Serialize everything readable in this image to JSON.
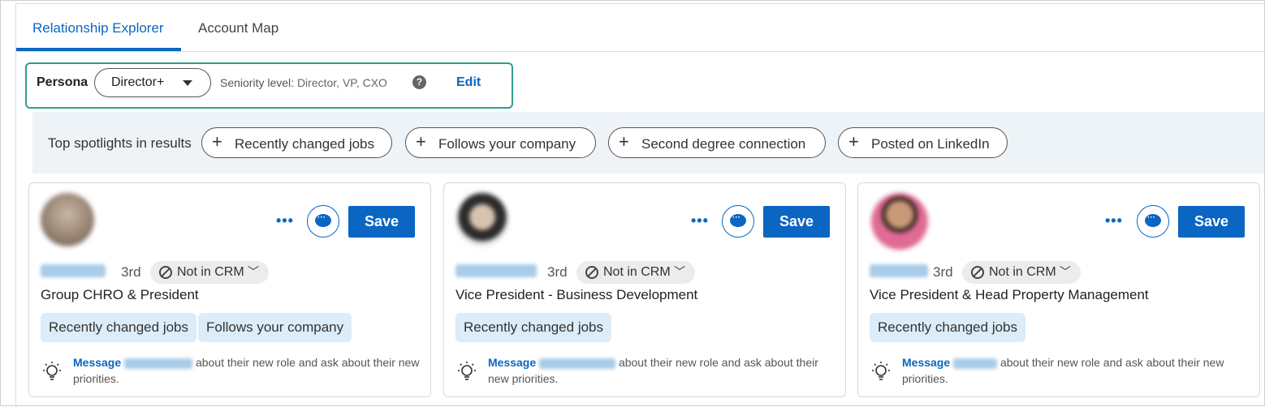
{
  "tabs": [
    {
      "label": "Relationship Explorer",
      "active": true
    },
    {
      "label": "Account Map",
      "active": false
    }
  ],
  "persona": {
    "label": "Persona",
    "selected": "Director+",
    "seniority_label": "Seniority level:",
    "seniority_value": "Director, VP, CXO",
    "edit_label": "Edit"
  },
  "spotlights": {
    "label": "Top spotlights in results",
    "items": [
      "Recently changed jobs",
      "Follows your company",
      "Second degree connection",
      "Posted on LinkedIn"
    ]
  },
  "colors": {
    "accent": "#0a66c2",
    "persona_border": "#2e9e8e",
    "tag_bg": "#dcecf8",
    "spotlight_bg": "#eef3f8"
  },
  "cards": [
    {
      "degree": "3rd",
      "crm": "Not in CRM",
      "title": "Group CHRO & President",
      "tags": [
        "Recently changed jobs",
        "Follows your company"
      ],
      "save_label": "Save",
      "tip_link": "Message",
      "tip_text": "about their new role and ask about their new priorities."
    },
    {
      "degree": "3rd",
      "crm": "Not in CRM",
      "title": "Vice President - Business Development",
      "tags": [
        "Recently changed jobs"
      ],
      "save_label": "Save",
      "tip_link": "Message",
      "tip_text": "about their new role and ask about their new priorities."
    },
    {
      "degree": "3rd",
      "crm": "Not in CRM",
      "title": "Vice President & Head Property Management",
      "tags": [
        "Recently changed jobs"
      ],
      "save_label": "Save",
      "tip_link": "Message",
      "tip_text": "about their new role and ask about their new priorities."
    }
  ]
}
